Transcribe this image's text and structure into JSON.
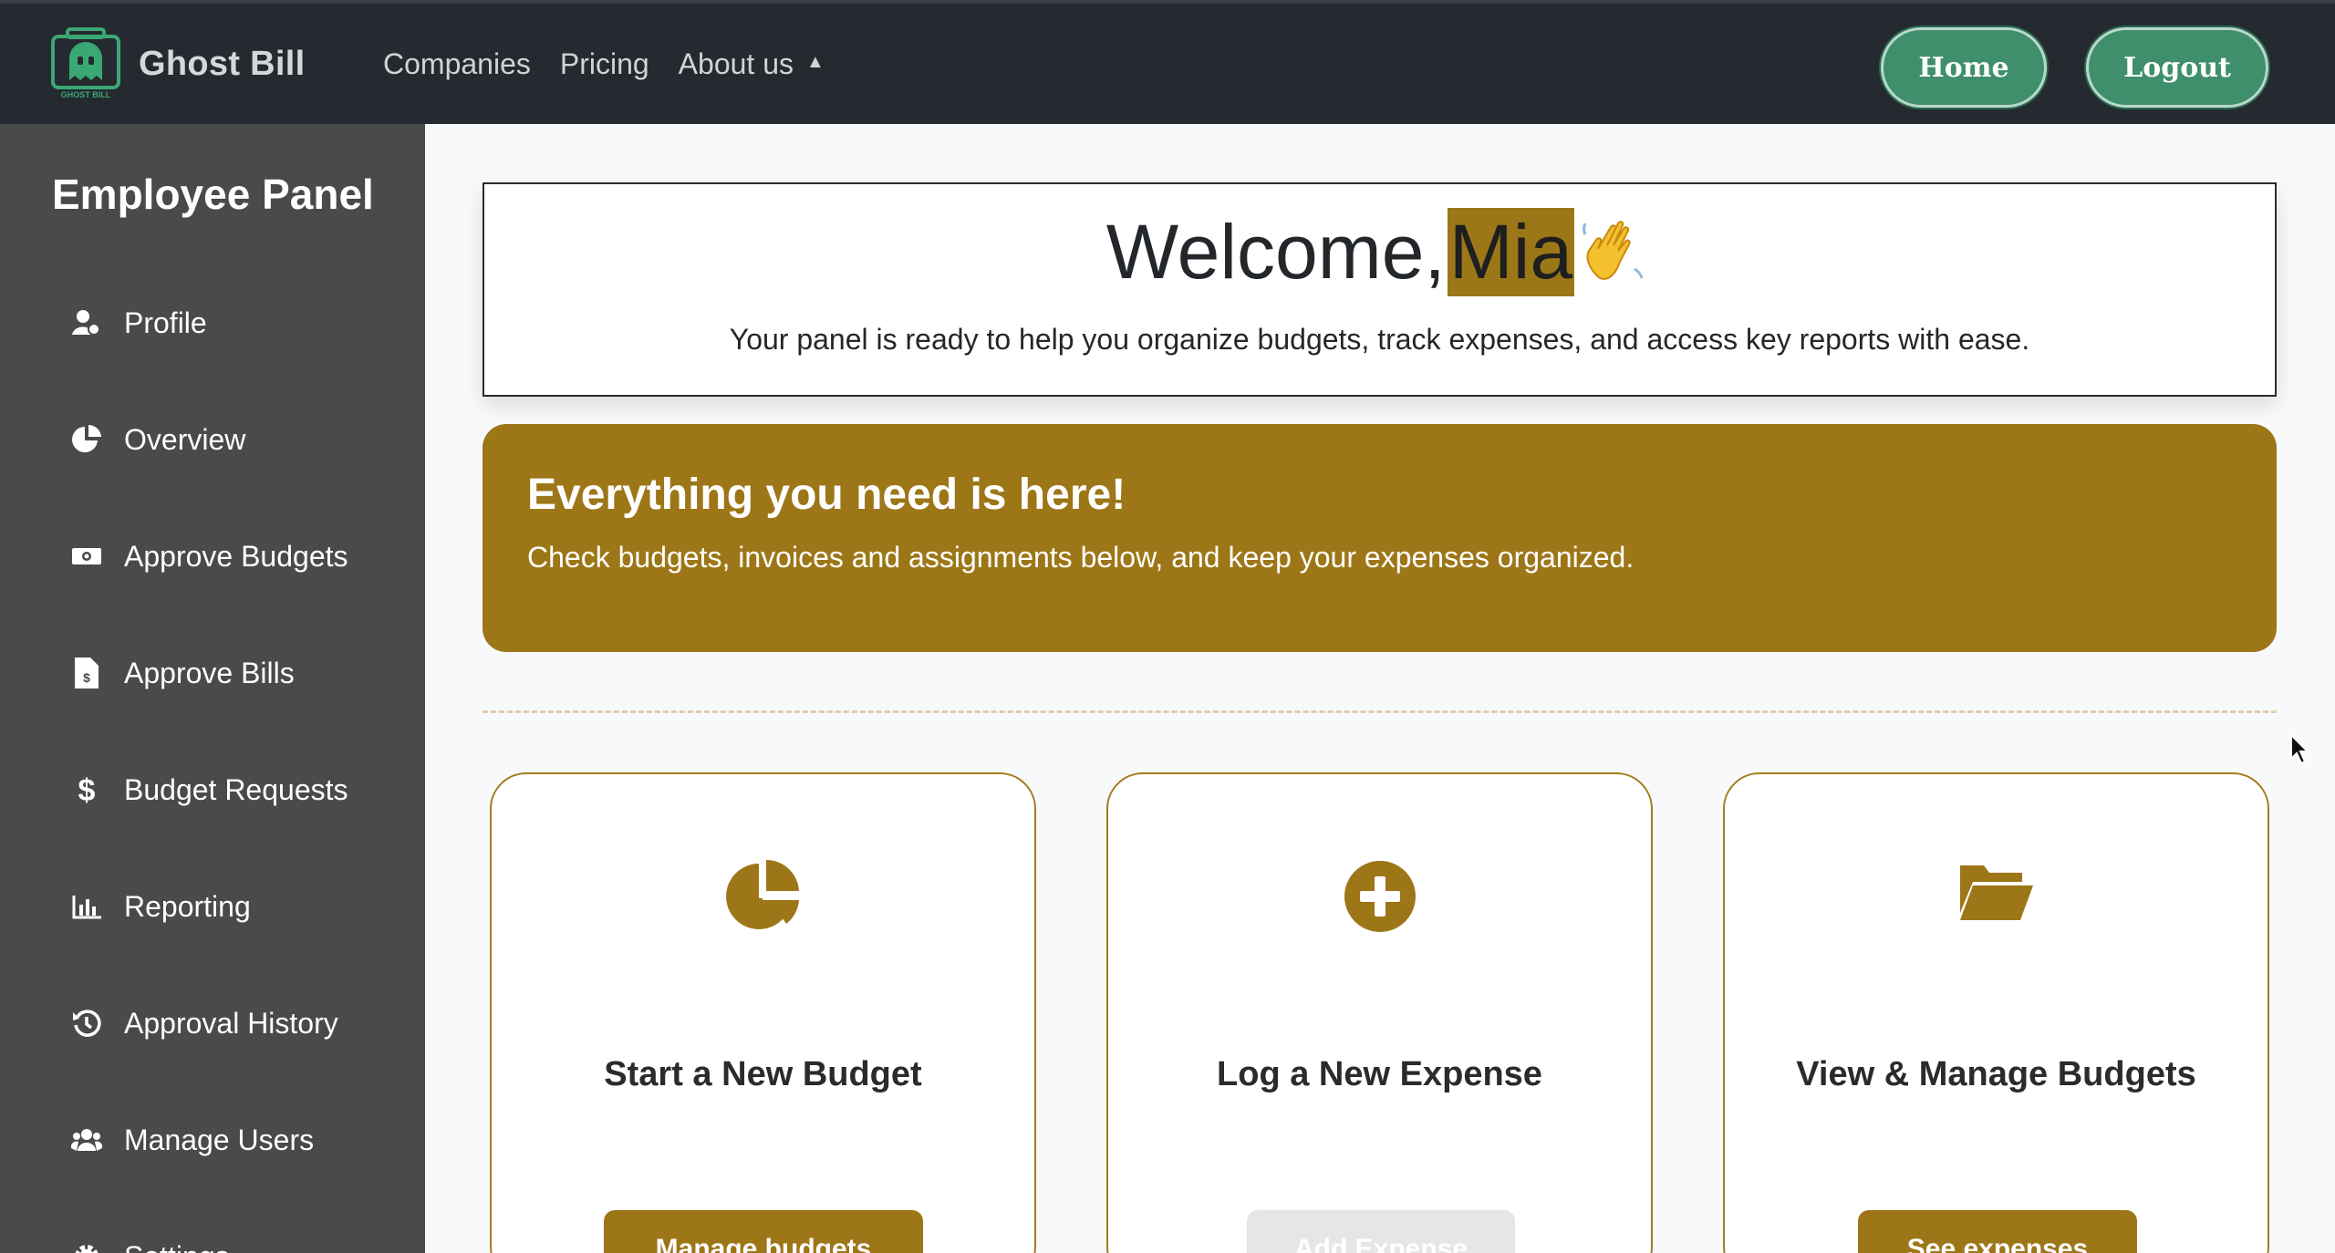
{
  "navbar": {
    "brand_name": "Ghost Bill",
    "logo_caption": "GHOST BILL",
    "links": [
      "Companies",
      "Pricing",
      "About us"
    ],
    "about_caret": "▲",
    "home_label": "Home",
    "logout_label": "Logout",
    "colors": {
      "background": "#252a30",
      "button": "#3f8f6d",
      "logo": "#3aa875"
    }
  },
  "sidebar": {
    "title": "Employee Panel",
    "items": [
      {
        "label": "Profile",
        "icon": "user-profile-icon"
      },
      {
        "label": "Overview",
        "icon": "pie-chart-icon"
      },
      {
        "label": "Approve Budgets",
        "icon": "money-bill-icon"
      },
      {
        "label": "Approve Bills",
        "icon": "invoice-dollar-icon"
      },
      {
        "label": "Budget Requests",
        "icon": "dollar-sign-icon"
      },
      {
        "label": "Reporting",
        "icon": "bar-chart-icon"
      },
      {
        "label": "Approval History",
        "icon": "history-icon"
      },
      {
        "label": "Manage Users",
        "icon": "users-icon"
      },
      {
        "label": "Settings",
        "icon": "gear-icon"
      }
    ]
  },
  "welcome": {
    "greeting": "Welcome,",
    "name": "Mia",
    "emoji_icon": "waving-hand-icon",
    "subtitle": "Your panel is ready to help you organize budgets, track expenses, and access key reports with ease."
  },
  "promo": {
    "title": "Everything you need is here!",
    "text": "Check budgets, invoices and assignments below, and keep your expenses organized.",
    "color": "#9d7617"
  },
  "cards": [
    {
      "title": "Start a New Budget",
      "icon": "pie-chart-icon",
      "button": "Manage budgets",
      "disabled": false
    },
    {
      "title": "Log a New Expense",
      "icon": "plus-circle-icon",
      "button": "Add Expense",
      "disabled": true
    },
    {
      "title": "View & Manage Budgets",
      "icon": "folder-open-icon",
      "button": "See expenses",
      "disabled": false
    }
  ],
  "accent_color": "#9d7617"
}
